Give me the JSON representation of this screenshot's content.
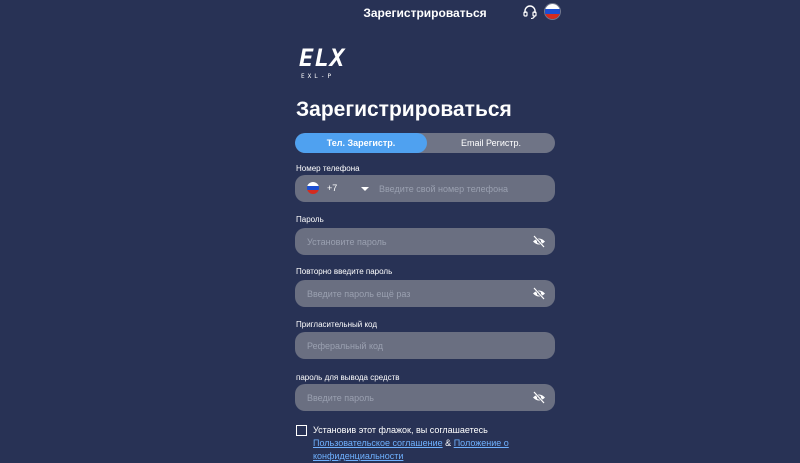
{
  "topbar": {
    "title": "Зарегистрироваться",
    "icons": {
      "support": "headset-icon",
      "language": "russia-flag-icon"
    }
  },
  "logo": {
    "main": "ELX",
    "sub": "EXL-P"
  },
  "page_title": "Зарегистрироваться",
  "tabs": [
    {
      "label": "Тел. Зарегистр.",
      "active": true
    },
    {
      "label": "Email Регистр.",
      "active": false
    }
  ],
  "fields": {
    "phone": {
      "label": "Номер телефона",
      "country_code": "+7",
      "placeholder": "Введите свой номер телефона",
      "value": ""
    },
    "password": {
      "label": "Пароль",
      "placeholder": "Установите пароль",
      "value": ""
    },
    "password_repeat": {
      "label": "Повторно введите пароль",
      "placeholder": "Введите пароль ещё раз",
      "value": ""
    },
    "invite_code": {
      "label": "Пригласительный код",
      "placeholder": "Реферальный код",
      "value": ""
    },
    "withdraw_password": {
      "label": "пароль для вывода средств",
      "placeholder": "Введите пароль",
      "value": ""
    }
  },
  "agreement": {
    "text": "Установив этот флажок, вы соглашаетесь",
    "link1": "Пользовательское соглашение",
    "amp": "&",
    "link2": "Положение о конфиденциальности"
  },
  "colors": {
    "background": "#283255",
    "accent": "#4fa1f0",
    "field": "#6a6f81",
    "link": "#6fb1ff"
  }
}
